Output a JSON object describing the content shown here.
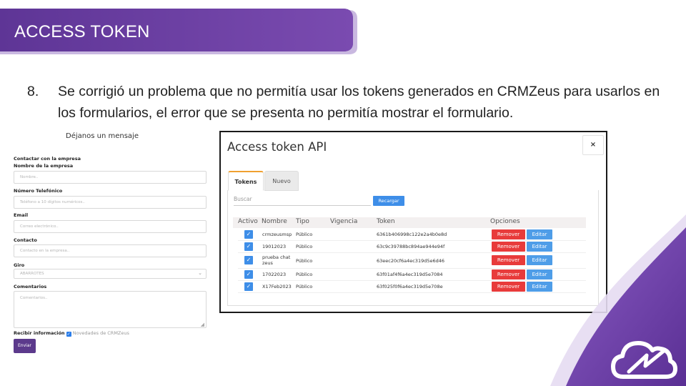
{
  "slide": {
    "title": "ACCESS TOKEN",
    "item_number": "8.",
    "item_text": "Se corrigió un problema que no permitía usar los tokens generados en CRMZeus para usarlos en los formularios, el error que se presenta no permitía mostrar el formulario."
  },
  "colors": {
    "banner_purple": "#6b3fa0",
    "remover_red": "#e83b3b",
    "editar_blue": "#4e9de8",
    "recargar_blue": "#3e8ee8",
    "enviar_purple": "#5c3a8c"
  },
  "form": {
    "title": "Déjanos un mensaje",
    "contactar_label": "Contactar con la empresa",
    "nombre_label": "Nombre de la empresa",
    "nombre_placeholder": "Nombre..",
    "telefono_label": "Número Telefónico",
    "telefono_placeholder": "Teléfono a 10 dígitos numéricos..",
    "email_label": "Email",
    "email_placeholder": "Correo electrónico..",
    "contacto_label": "Contacto",
    "contacto_placeholder": "Contacto en la empresa..",
    "giro_label": "Giro",
    "giro_value": "ABARROTES",
    "comentarios_label": "Comentarios",
    "comentarios_placeholder": "Comentarios..",
    "recibir_label": "Recibir información",
    "novedades_label": "Novedades de CRMZeus",
    "submit_label": "Enviar"
  },
  "modal": {
    "title": "Access token API",
    "close_label": "×",
    "tabs": [
      "Tokens",
      "Nuevo"
    ],
    "search_placeholder": "Buscar",
    "reload_label": "Recargar",
    "columns": [
      "Activo",
      "Nombre",
      "Tipo",
      "Vigencia",
      "Token",
      "Opciones"
    ],
    "remove_label": "Remover",
    "edit_label": "Editar",
    "rows": [
      {
        "name": "crmzeusmsp",
        "type": "Público",
        "vigencia": "",
        "token": "6361b406998c122e2a4b0e8d"
      },
      {
        "name": "19012023",
        "type": "Público",
        "vigencia": "",
        "token": "63c9c39788bc894ae944e94f"
      },
      {
        "name": "prueba chat zeus",
        "type": "Público",
        "vigencia": "",
        "token": "63eec20cf6a4ec319d5e6d46"
      },
      {
        "name": "17022023",
        "type": "Público",
        "vigencia": "",
        "token": "63f01af4f6a4ec319d5e7084"
      },
      {
        "name": "X17Feb2023",
        "type": "Público",
        "vigencia": "",
        "token": "63f025f0f6a4ec319d5e708e"
      }
    ]
  }
}
